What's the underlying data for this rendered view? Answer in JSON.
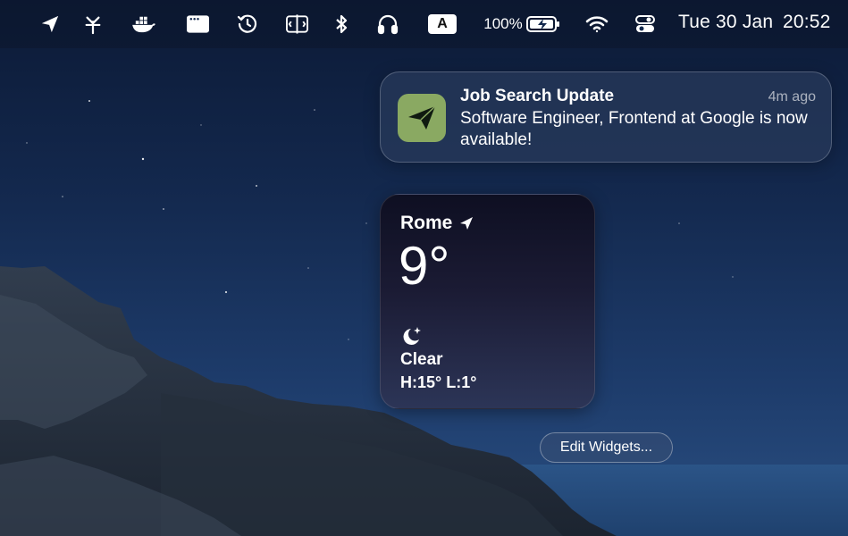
{
  "menubar": {
    "icons": [
      "send-icon",
      "fork-icon",
      "docker-icon",
      "window-icon",
      "time-machine-icon",
      "split-view-icon",
      "bluetooth-icon",
      "headphones-icon",
      "keyboard-input-icon",
      "battery-icon",
      "wifi-icon",
      "control-center-icon"
    ],
    "input_source": "A",
    "battery_percent": "100%",
    "date": "Tue 30 Jan",
    "time": "20:52"
  },
  "notification": {
    "title": "Job Search Update",
    "time_ago": "4m ago",
    "body": "Software Engineer, Frontend at Google is now available!",
    "app_icon": "paper-plane-icon",
    "app_icon_color": "#8aa962"
  },
  "weather": {
    "city": "Rome",
    "temperature": "9°",
    "condition": "Clear",
    "high_low": "H:15° L:1°",
    "icon": "moon-stars-icon"
  },
  "edit_widgets_label": "Edit Widgets..."
}
